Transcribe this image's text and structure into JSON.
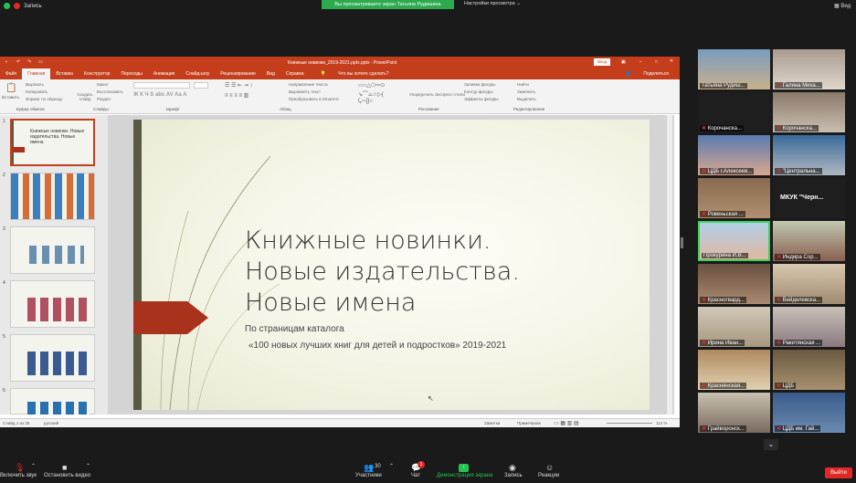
{
  "topbar": {
    "record_label": "Запись",
    "sharing_banner": "Вы просматриваете экран Татьяна Рудишина",
    "view_options": "Настройки просмотра",
    "view_label": "Вид"
  },
  "ppt": {
    "window_title": "Книжные новинки_2019-2021.pptx.pptx  -  PowerPoint",
    "login": "Вход",
    "tabs": [
      "Файл",
      "Главная",
      "Вставка",
      "Конструктор",
      "Переходы",
      "Анимация",
      "Слайд-шоу",
      "Рецензирование",
      "Вид",
      "Справка",
      "Что вы хотите сделать?"
    ],
    "share": "Поделиться",
    "ribbon": {
      "paste": "Вставить",
      "cut": "Вырезать",
      "copy": "Копировать",
      "format_painter": "Формат по образцу",
      "clipboard": "Буфер обмена",
      "new_slide": "Создать слайд",
      "layout": "Макет",
      "reset": "Восстановить",
      "section": "Раздел",
      "slides": "Слайды",
      "font": "Шрифт",
      "paragraph": "Абзац",
      "text_direction": "Направление текста",
      "align_text": "Выровнять текст",
      "smartart": "Преобразовать в SmartArt",
      "arrange": "Упорядочить",
      "quick_styles": "Экспресс-стили",
      "drawing": "Рисование",
      "shape_fill": "Заливка фигуры",
      "shape_outline": "Контур фигуры",
      "shape_effects": "Эффекты фигуры",
      "find": "Найти",
      "replace": "Заменить",
      "select": "Выделить",
      "editing": "Редактирование"
    },
    "slide_numbers": [
      "1",
      "2",
      "3",
      "4",
      "5",
      "6"
    ],
    "thumb1_text": "Книжные новинки. Новые издательства. Новые имена",
    "slide": {
      "title_line1": "Книжные новинки.",
      "title_line2": "Новые издательства.",
      "title_line3": "Новые имена",
      "subtitle1": "По страницам каталога",
      "subtitle2": "«100 новых лучших книг для детей и подростков» 2019-2021"
    },
    "status": {
      "slide_count": "Слайд 1 из 25",
      "language": "русский",
      "notes": "Заметки",
      "comments": "Примечания",
      "zoom": "114 %"
    }
  },
  "gallery": [
    {
      "name": "Татьяна Рудиш..."
    },
    {
      "name": "Галина Миха..."
    },
    {
      "name": "Корочанска..."
    },
    {
      "name": "Корочанска..."
    },
    {
      "name": "ЦДБ г.Алексеев..."
    },
    {
      "name": "\"Центральна..."
    },
    {
      "name": "Ровеньская ..."
    },
    {
      "name": "МКУК  \"Черн..."
    },
    {
      "name": "Прокурина И.В..."
    },
    {
      "name": "Индира Сор..."
    },
    {
      "name": "Красногвард..."
    },
    {
      "name": "Вейделевска..."
    },
    {
      "name": "Ирина Иван..."
    },
    {
      "name": "Ракитянская ..."
    },
    {
      "name": "Краснянская..."
    },
    {
      "name": "ЦДБ"
    },
    {
      "name": "Грайворонск..."
    },
    {
      "name": "ЦДБ им. Гай..."
    }
  ],
  "toolbar": {
    "mute": "Включить звук",
    "video": "Остановить видео",
    "participants": "Участники",
    "participants_count": "30",
    "chat": "Чат",
    "chat_badge": "1",
    "share": "Демонстрация экрана",
    "record": "Запись",
    "reactions": "Реакции",
    "leave": "Выйти"
  }
}
